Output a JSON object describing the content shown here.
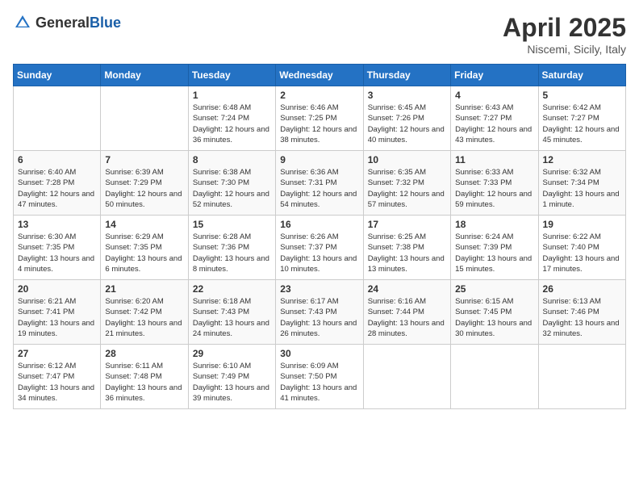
{
  "header": {
    "logo_general": "General",
    "logo_blue": "Blue",
    "month_title": "April 2025",
    "location": "Niscemi, Sicily, Italy"
  },
  "days_of_week": [
    "Sunday",
    "Monday",
    "Tuesday",
    "Wednesday",
    "Thursday",
    "Friday",
    "Saturday"
  ],
  "weeks": [
    [
      {
        "day": "",
        "info": ""
      },
      {
        "day": "",
        "info": ""
      },
      {
        "day": "1",
        "info": "Sunrise: 6:48 AM\nSunset: 7:24 PM\nDaylight: 12 hours and 36 minutes."
      },
      {
        "day": "2",
        "info": "Sunrise: 6:46 AM\nSunset: 7:25 PM\nDaylight: 12 hours and 38 minutes."
      },
      {
        "day": "3",
        "info": "Sunrise: 6:45 AM\nSunset: 7:26 PM\nDaylight: 12 hours and 40 minutes."
      },
      {
        "day": "4",
        "info": "Sunrise: 6:43 AM\nSunset: 7:27 PM\nDaylight: 12 hours and 43 minutes."
      },
      {
        "day": "5",
        "info": "Sunrise: 6:42 AM\nSunset: 7:27 PM\nDaylight: 12 hours and 45 minutes."
      }
    ],
    [
      {
        "day": "6",
        "info": "Sunrise: 6:40 AM\nSunset: 7:28 PM\nDaylight: 12 hours and 47 minutes."
      },
      {
        "day": "7",
        "info": "Sunrise: 6:39 AM\nSunset: 7:29 PM\nDaylight: 12 hours and 50 minutes."
      },
      {
        "day": "8",
        "info": "Sunrise: 6:38 AM\nSunset: 7:30 PM\nDaylight: 12 hours and 52 minutes."
      },
      {
        "day": "9",
        "info": "Sunrise: 6:36 AM\nSunset: 7:31 PM\nDaylight: 12 hours and 54 minutes."
      },
      {
        "day": "10",
        "info": "Sunrise: 6:35 AM\nSunset: 7:32 PM\nDaylight: 12 hours and 57 minutes."
      },
      {
        "day": "11",
        "info": "Sunrise: 6:33 AM\nSunset: 7:33 PM\nDaylight: 12 hours and 59 minutes."
      },
      {
        "day": "12",
        "info": "Sunrise: 6:32 AM\nSunset: 7:34 PM\nDaylight: 13 hours and 1 minute."
      }
    ],
    [
      {
        "day": "13",
        "info": "Sunrise: 6:30 AM\nSunset: 7:35 PM\nDaylight: 13 hours and 4 minutes."
      },
      {
        "day": "14",
        "info": "Sunrise: 6:29 AM\nSunset: 7:35 PM\nDaylight: 13 hours and 6 minutes."
      },
      {
        "day": "15",
        "info": "Sunrise: 6:28 AM\nSunset: 7:36 PM\nDaylight: 13 hours and 8 minutes."
      },
      {
        "day": "16",
        "info": "Sunrise: 6:26 AM\nSunset: 7:37 PM\nDaylight: 13 hours and 10 minutes."
      },
      {
        "day": "17",
        "info": "Sunrise: 6:25 AM\nSunset: 7:38 PM\nDaylight: 13 hours and 13 minutes."
      },
      {
        "day": "18",
        "info": "Sunrise: 6:24 AM\nSunset: 7:39 PM\nDaylight: 13 hours and 15 minutes."
      },
      {
        "day": "19",
        "info": "Sunrise: 6:22 AM\nSunset: 7:40 PM\nDaylight: 13 hours and 17 minutes."
      }
    ],
    [
      {
        "day": "20",
        "info": "Sunrise: 6:21 AM\nSunset: 7:41 PM\nDaylight: 13 hours and 19 minutes."
      },
      {
        "day": "21",
        "info": "Sunrise: 6:20 AM\nSunset: 7:42 PM\nDaylight: 13 hours and 21 minutes."
      },
      {
        "day": "22",
        "info": "Sunrise: 6:18 AM\nSunset: 7:43 PM\nDaylight: 13 hours and 24 minutes."
      },
      {
        "day": "23",
        "info": "Sunrise: 6:17 AM\nSunset: 7:43 PM\nDaylight: 13 hours and 26 minutes."
      },
      {
        "day": "24",
        "info": "Sunrise: 6:16 AM\nSunset: 7:44 PM\nDaylight: 13 hours and 28 minutes."
      },
      {
        "day": "25",
        "info": "Sunrise: 6:15 AM\nSunset: 7:45 PM\nDaylight: 13 hours and 30 minutes."
      },
      {
        "day": "26",
        "info": "Sunrise: 6:13 AM\nSunset: 7:46 PM\nDaylight: 13 hours and 32 minutes."
      }
    ],
    [
      {
        "day": "27",
        "info": "Sunrise: 6:12 AM\nSunset: 7:47 PM\nDaylight: 13 hours and 34 minutes."
      },
      {
        "day": "28",
        "info": "Sunrise: 6:11 AM\nSunset: 7:48 PM\nDaylight: 13 hours and 36 minutes."
      },
      {
        "day": "29",
        "info": "Sunrise: 6:10 AM\nSunset: 7:49 PM\nDaylight: 13 hours and 39 minutes."
      },
      {
        "day": "30",
        "info": "Sunrise: 6:09 AM\nSunset: 7:50 PM\nDaylight: 13 hours and 41 minutes."
      },
      {
        "day": "",
        "info": ""
      },
      {
        "day": "",
        "info": ""
      },
      {
        "day": "",
        "info": ""
      }
    ]
  ]
}
